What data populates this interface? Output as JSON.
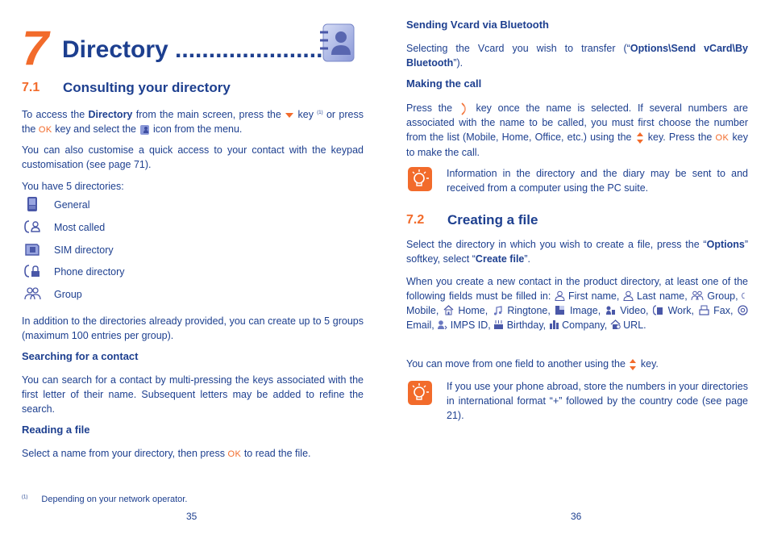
{
  "left_page": {
    "chapter": {
      "number": "7",
      "title": "Directory ......................",
      "icon": "directory-book-icon"
    },
    "section_7_1": {
      "number": "7.1",
      "title": "Consulting your directory"
    },
    "intro": {
      "part1": "To access the ",
      "bold1": "Directory",
      "part2": " from the main screen, press the ",
      "key_icon": "down-arrow-key-icon",
      "part3": " key ",
      "footnote_ref": "(1)",
      "part4": " or press the ",
      "ok_label": "OK",
      "part5": " key and select the ",
      "menu_icon": "directory-menu-icon",
      "part6": " icon from the menu."
    },
    "customise": "You can also customise a quick access to your contact with the keypad customisation (see page 71).",
    "have_dirs": "You have 5 directories:",
    "directories": [
      {
        "label": "General",
        "icon": "general-directory-icon"
      },
      {
        "label": "Most called",
        "icon": "most-called-icon"
      },
      {
        "label": "SIM directory",
        "icon": "sim-card-icon"
      },
      {
        "label": "Phone directory",
        "icon": "phone-lock-icon"
      },
      {
        "label": "Group",
        "icon": "group-icon"
      }
    ],
    "groups_text": "In addition to the directories already provided, you can create up to 5 groups (maximum 100 entries per group).",
    "searching": {
      "heading": "Searching for a contact",
      "text": "You can search for a contact by multi-pressing the keys associated with the first letter of their name. Subsequent letters may be added to refine the search."
    },
    "reading": {
      "heading": "Reading a file",
      "part1": "Select a name from your directory, then press ",
      "ok_label": "OK",
      "part2": " to read the file."
    },
    "footnote": {
      "mark": "(1)",
      "text": "Depending on your network operator."
    },
    "page_number": "35"
  },
  "right_page": {
    "sending": {
      "heading": "Sending Vcard via Bluetooth",
      "part1": "Selecting the Vcard you wish to transfer (“",
      "bold": "Options\\Send vCard\\By Bluetooth",
      "part2": "”)."
    },
    "making_call": {
      "heading": "Making the call",
      "part1": "Press the ",
      "call_icon": "call-key-icon",
      "part2": " key once the name is selected. If several numbers are associated with the name to be called, you must first choose the number from the list (Mobile, Home, Office, etc.) using the ",
      "nav_icon": "up-down-nav-key-icon",
      "part3": " key. Press the ",
      "ok_label": "OK",
      "part4": " key to make the call."
    },
    "tip1": {
      "icon": "lightbulb-tip-icon",
      "text": "Information in the directory and the diary may be sent to and received from a computer using the PC suite."
    },
    "section_7_2": {
      "number": "7.2",
      "title": "Creating a file"
    },
    "select_dir": {
      "part1": "Select the directory in which you wish to create a file, press the “",
      "bold1": "Options",
      "part2": "” softkey, select “",
      "bold2": "Create file",
      "part3": "”."
    },
    "fields_intro": "When you create a new contact in the product directory, at least one of the following fields must be filled in:",
    "fields": [
      {
        "label": "First name",
        "icon": "person-icon"
      },
      {
        "label": "Last name",
        "icon": "person-icon"
      },
      {
        "label": "Group",
        "icon": "group-icon"
      },
      {
        "label": "Mobile",
        "icon": "mobile-icon"
      },
      {
        "label": "Home",
        "icon": "home-icon"
      },
      {
        "label": "Ringtone",
        "icon": "music-note-icon"
      },
      {
        "label": "Image",
        "icon": "image-icon"
      },
      {
        "label": "Video",
        "icon": "video-icon"
      },
      {
        "label": "Work",
        "icon": "work-phone-icon"
      },
      {
        "label": "Fax",
        "icon": "fax-icon"
      },
      {
        "label": "Email",
        "icon": "email-at-icon"
      },
      {
        "label": "IMPS ID",
        "icon": "imps-icon"
      },
      {
        "label": "Birthday",
        "icon": "birthday-cake-icon"
      },
      {
        "label": "Company",
        "icon": "company-building-icon"
      },
      {
        "label": "URL",
        "icon": "url-home-icon"
      }
    ],
    "move_fields": {
      "part1": "You can move from one field to another using the ",
      "nav_icon": "up-down-nav-key-icon",
      "part2": " key."
    },
    "tip2": {
      "icon": "lightbulb-tip-icon",
      "text": "If you use your phone abroad, store the numbers in your directories in international format “+” followed by the country code (see page 21)."
    },
    "page_number": "36"
  },
  "colors": {
    "text_blue": "#1d3f8f",
    "accent_orange": "#f26b2b"
  }
}
